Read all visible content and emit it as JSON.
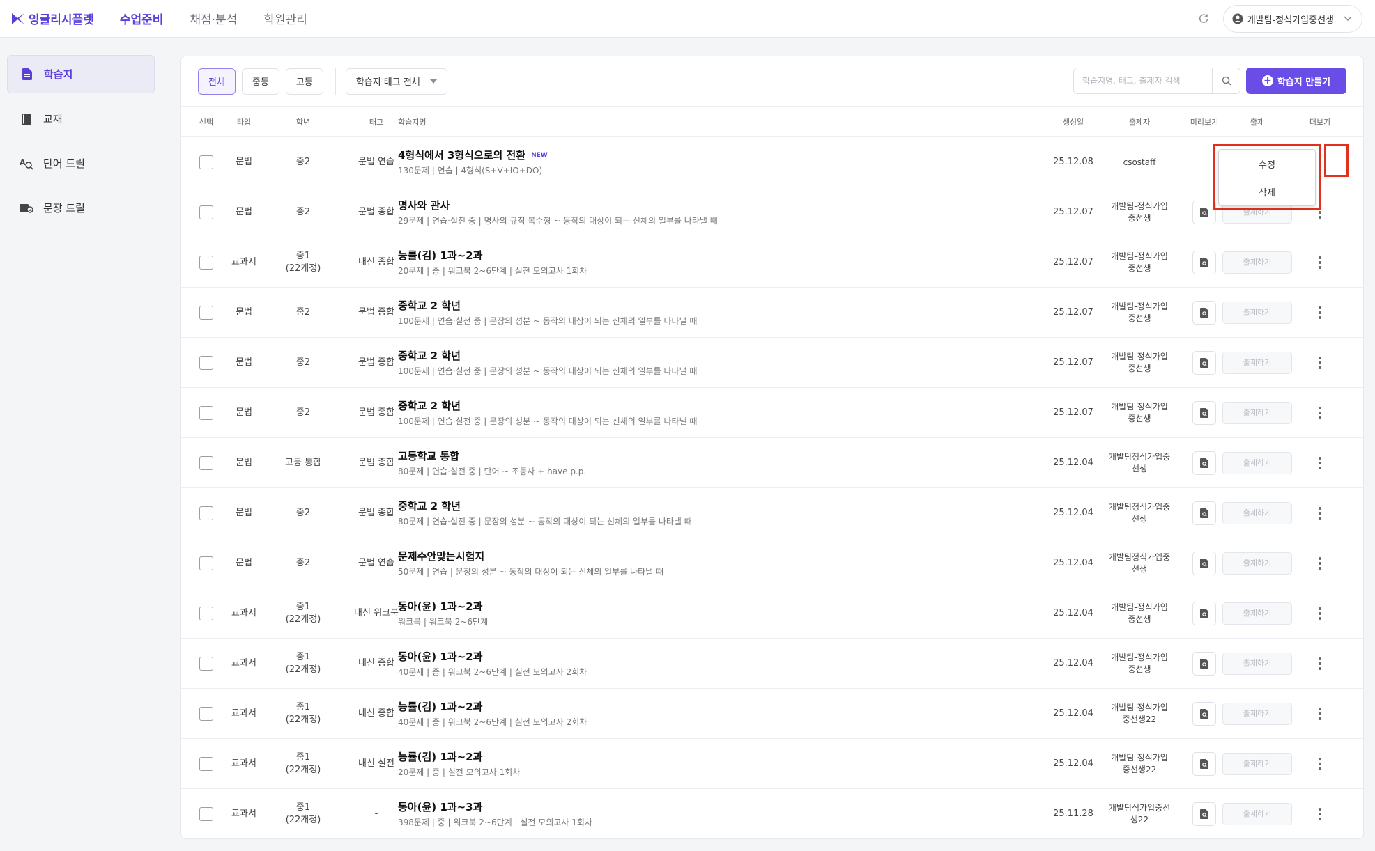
{
  "header": {
    "brand": "잉글리시플랫",
    "nav": [
      "수업준비",
      "채점·분석",
      "학원관리"
    ],
    "user": "개발팀-정식가입중선생"
  },
  "sidebar": {
    "items": [
      "학습지",
      "교재",
      "단어 드릴",
      "문장 드릴"
    ]
  },
  "toolbar": {
    "filters": [
      "전체",
      "중등",
      "고등"
    ],
    "tag_select": "학습지 태그 전체",
    "search_placeholder": "학습지명, 태그, 출제자 검색",
    "create_label": "학습지 만들기"
  },
  "table": {
    "headers": [
      "선택",
      "타입",
      "학년",
      "태그",
      "학습지명",
      "생성일",
      "출제자",
      "미리보기",
      "출제",
      "더보기"
    ],
    "issue_label": "출제하기",
    "new_badge": "NEW",
    "rows": [
      {
        "type": "문법",
        "grade": [
          "중2"
        ],
        "tag": "문법 연습",
        "title": "4형식에서 3형식으로의 전환",
        "is_new": true,
        "sub": "130문제 | 연습 | 4형식(S+V+IO+DO)",
        "date": "25.12.08",
        "author": [
          "csostaff"
        ]
      },
      {
        "type": "문법",
        "grade": [
          "중2"
        ],
        "tag": "문법 종합",
        "title": "명사와 관사",
        "sub": "29문제 | 연습·실전 중 | 명사의 규칙 복수형 ~ 동작의 대상이 되는 신체의 일부를 나타낼 때",
        "date": "25.12.07",
        "author": [
          "개발팀-정식가입",
          "중선생"
        ]
      },
      {
        "type": "교과서",
        "grade": [
          "중1",
          "(22개정)"
        ],
        "tag": "내신 종합",
        "title": "능률(김) 1과~2과",
        "sub": "20문제 | 중 | 워크북 2~6단계 | 실전 모의고사 1회차",
        "date": "25.12.07",
        "author": [
          "개발팀-정식가입",
          "중선생"
        ]
      },
      {
        "type": "문법",
        "grade": [
          "중2"
        ],
        "tag": "문법 종합",
        "title": "중학교 2 학년",
        "sub": "100문제 | 연습·실전 중 | 문장의 성분 ~ 동작의 대상이 되는 신체의 일부를 나타낼 때",
        "date": "25.12.07",
        "author": [
          "개발팀-정식가입",
          "중선생"
        ]
      },
      {
        "type": "문법",
        "grade": [
          "중2"
        ],
        "tag": "문법 종합",
        "title": "중학교 2 학년",
        "sub": "100문제 | 연습·실전 중 | 문장의 성분 ~ 동작의 대상이 되는 신체의 일부를 나타낼 때",
        "date": "25.12.07",
        "author": [
          "개발팀-정식가입",
          "중선생"
        ]
      },
      {
        "type": "문법",
        "grade": [
          "중2"
        ],
        "tag": "문법 종합",
        "title": "중학교 2 학년",
        "sub": "100문제 | 연습·실전 중 | 문장의 성분 ~ 동작의 대상이 되는 신체의 일부를 나타낼 때",
        "date": "25.12.07",
        "author": [
          "개발팀-정식가입",
          "중선생"
        ]
      },
      {
        "type": "문법",
        "grade": [
          "고등 통합"
        ],
        "tag": "문법 종합",
        "title": "고등학교 통합",
        "sub": "80문제 | 연습·실전 중 | 단어 ~ 조동사 + have p.p.",
        "date": "25.12.04",
        "author": [
          "개발팀정식가입중",
          "선생"
        ]
      },
      {
        "type": "문법",
        "grade": [
          "중2"
        ],
        "tag": "문법 종합",
        "title": "중학교 2 학년",
        "sub": "80문제 | 연습·실전 중 | 문장의 성분 ~ 동작의 대상이 되는 신체의 일부를 나타낼 때",
        "date": "25.12.04",
        "author": [
          "개발팀정식가입중",
          "선생"
        ]
      },
      {
        "type": "문법",
        "grade": [
          "중2"
        ],
        "tag": "문법 연습",
        "title": "문제수안맞는시험지",
        "sub": "50문제 | 연습 | 문장의 성분 ~ 동작의 대상이 되는 신체의 일부를 나타낼 때",
        "date": "25.12.04",
        "author": [
          "개발팀정식가입중",
          "선생"
        ]
      },
      {
        "type": "교과서",
        "grade": [
          "중1",
          "(22개정)"
        ],
        "tag": "내신 워크북",
        "title": "동아(윤) 1과~2과",
        "sub": "워크북 | 워크북 2~6단계",
        "date": "25.12.04",
        "author": [
          "개발팀-정식가입",
          "중선생"
        ]
      },
      {
        "type": "교과서",
        "grade": [
          "중1",
          "(22개정)"
        ],
        "tag": "내신 종합",
        "title": "동아(윤) 1과~2과",
        "sub": "40문제 | 중 | 워크북 2~6단계 | 실전 모의고사 2회차",
        "date": "25.12.04",
        "author": [
          "개발팀-정식가입",
          "중선생"
        ]
      },
      {
        "type": "교과서",
        "grade": [
          "중1",
          "(22개정)"
        ],
        "tag": "내신 종합",
        "title": "능률(김) 1과~2과",
        "sub": "40문제 | 중 | 워크북 2~6단계 | 실전 모의고사 2회차",
        "date": "25.12.04",
        "author": [
          "개발팀-정식가입",
          "중선생22"
        ]
      },
      {
        "type": "교과서",
        "grade": [
          "중1",
          "(22개정)"
        ],
        "tag": "내신 실전",
        "title": "능률(김) 1과~2과",
        "sub": "20문제 | 중 | 실전 모의고사 1회차",
        "date": "25.12.04",
        "author": [
          "개발팀-정식가입",
          "중선생22"
        ]
      },
      {
        "type": "교과서",
        "grade": [
          "중1",
          "(22개정)"
        ],
        "tag": "-",
        "title": "동아(윤) 1과~3과",
        "sub": "398문제 | 중 | 워크북 2~6단계 | 실전 모의고사 1회차",
        "date": "25.11.28",
        "author": [
          "개발팀식가입중선",
          "생22"
        ]
      }
    ]
  },
  "menu": {
    "edit": "수정",
    "delete": "삭제"
  },
  "colors": {
    "accent": "#6a4ce6",
    "highlight": "#e0301e"
  }
}
